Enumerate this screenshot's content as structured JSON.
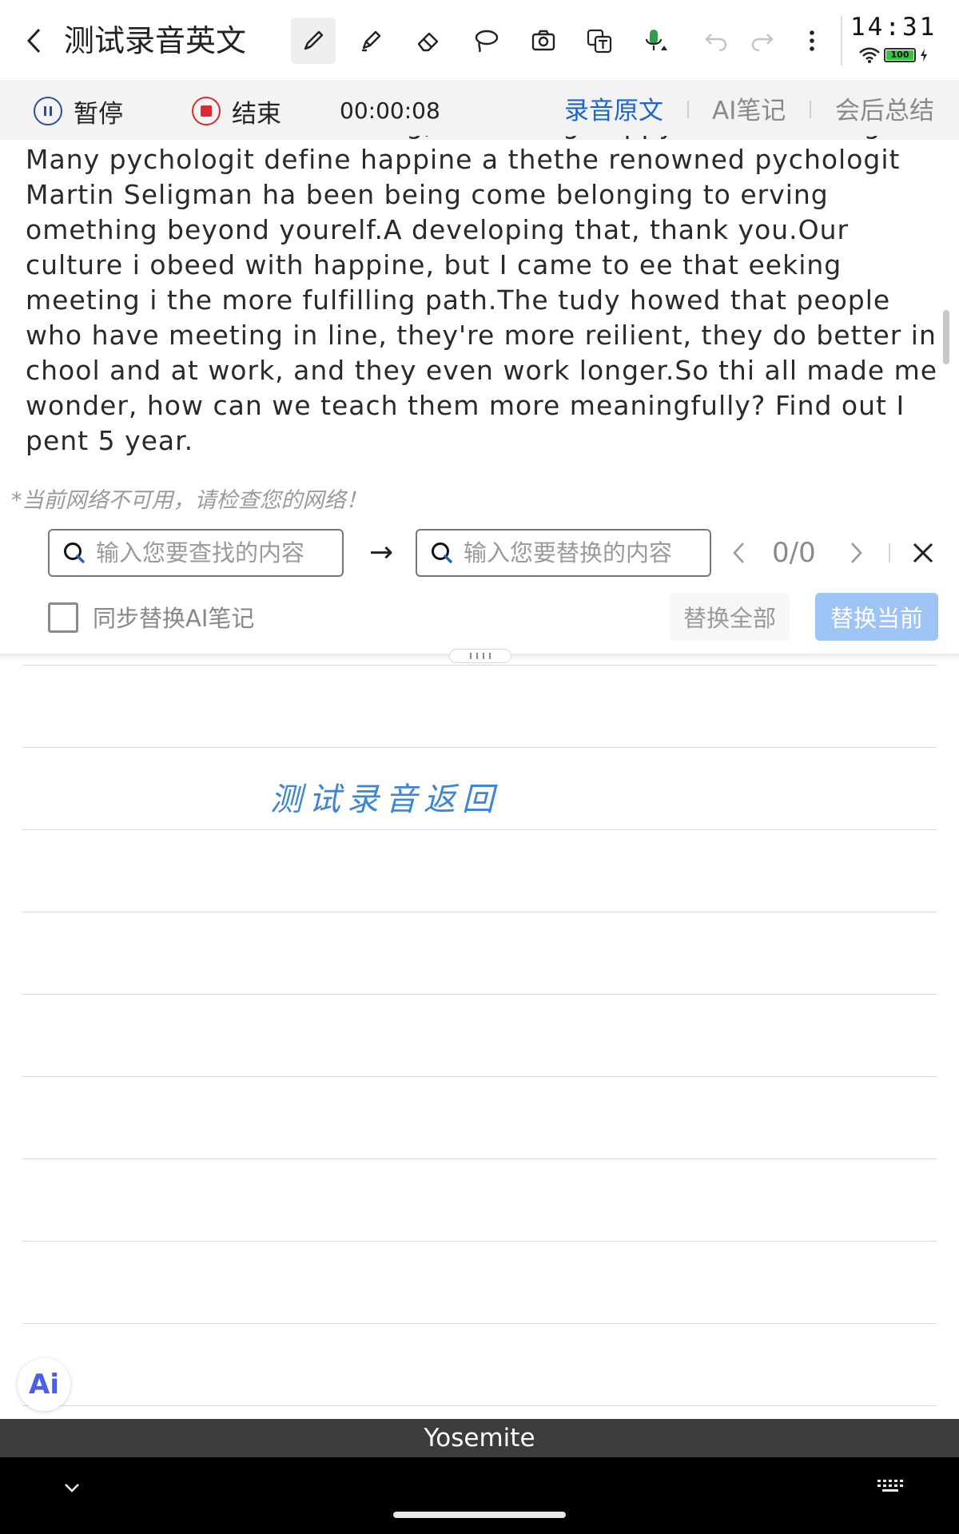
{
  "header": {
    "title": "测试录音英文",
    "tools": [
      "pen-icon",
      "highlighter-icon",
      "eraser-icon",
      "lasso-icon",
      "camera-icon",
      "text-translate-icon",
      "mic-icon",
      "undo-icon",
      "redo-icon",
      "more-icon"
    ],
    "active_tool": "pen-icon"
  },
  "status": {
    "time": "14:31",
    "battery": "100"
  },
  "recording": {
    "pause_label": "暂停",
    "stop_label": "结束",
    "elapsed": "00:00:08",
    "tabs": [
      {
        "label": "录音原文",
        "active": true
      },
      {
        "label": "AI笔记",
        "active": false
      },
      {
        "label": "会后总结",
        "active": false
      }
    ]
  },
  "transcript": {
    "clipped_line": "What makes life worth living, is it being happy? Is it meaning? What is meaning?",
    "text": "Many pychologit define happine a thethe renowned pychologit Martin Seligman ha been being come belonging to erving omething beyond yourelf.A developing that, thank you.Our culture i obeed with happine, but I came to ee that eeking meeting i the more fulfilling path.The tudy howed that people who have meeting in line, they're more reilient, they do better in chool and at work, and they even work longer.So thi all made me wonder, how can we teach them more meaningfully? Find out I pent 5 year."
  },
  "network_warning": "*当前网络不可用，请检查您的网络！",
  "find_replace": {
    "find_placeholder": "输入您要查找的内容",
    "replace_placeholder": "输入您要替换的内容",
    "arrow": "→",
    "count": "0/0",
    "sync_label": "同步替换AI笔记",
    "sync_checked": false,
    "replace_all_label": "替换全部",
    "replace_current_label": "替换当前"
  },
  "note": {
    "handwriting": "测试录音返回"
  },
  "ai_button_label": "Ai",
  "keyboard_suggestion": "Yosemite",
  "colors": {
    "accent": "#1f64c9",
    "stop": "#d92a35",
    "handwriting": "#3d86d4",
    "primary_disabled": "#9ec3f5"
  }
}
